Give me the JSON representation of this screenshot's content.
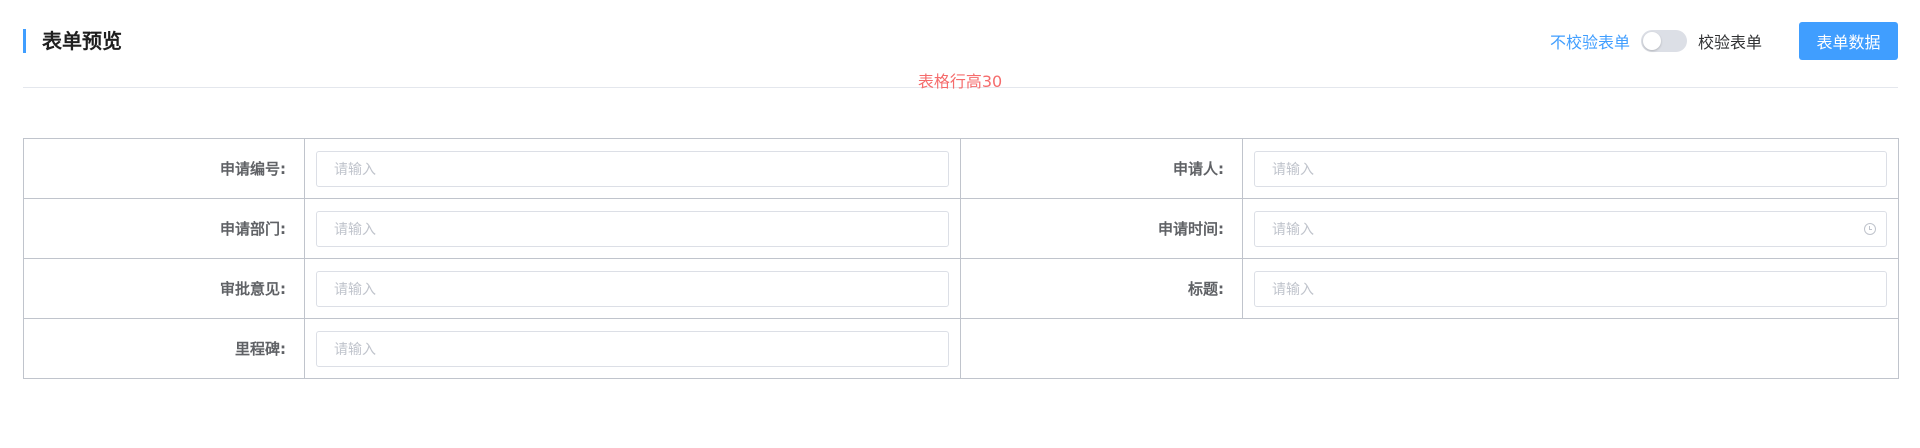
{
  "header": {
    "title": "表单预览",
    "validate_off_label": "不校验表单",
    "validate_on_label": "校验表单",
    "form_data_button": "表单数据"
  },
  "note": "表格行高30",
  "colors": {
    "accent": "#409eff",
    "note": "#f56c6c",
    "border": "#c0c4cc"
  },
  "form": {
    "rows": [
      {
        "left_label": "申请编号:",
        "left_placeholder": "请输入",
        "right_label": "申请人:",
        "right_placeholder": "请输入"
      },
      {
        "left_label": "申请部门:",
        "left_placeholder": "请输入",
        "right_label": "申请时间:",
        "right_placeholder": "请输入"
      },
      {
        "left_label": "审批意见:",
        "left_placeholder": "请输入",
        "right_label": "标题:",
        "right_placeholder": "请输入"
      },
      {
        "left_label": "里程碑:",
        "left_placeholder": "请输入"
      }
    ],
    "time_field_icon": "clock-icon"
  }
}
